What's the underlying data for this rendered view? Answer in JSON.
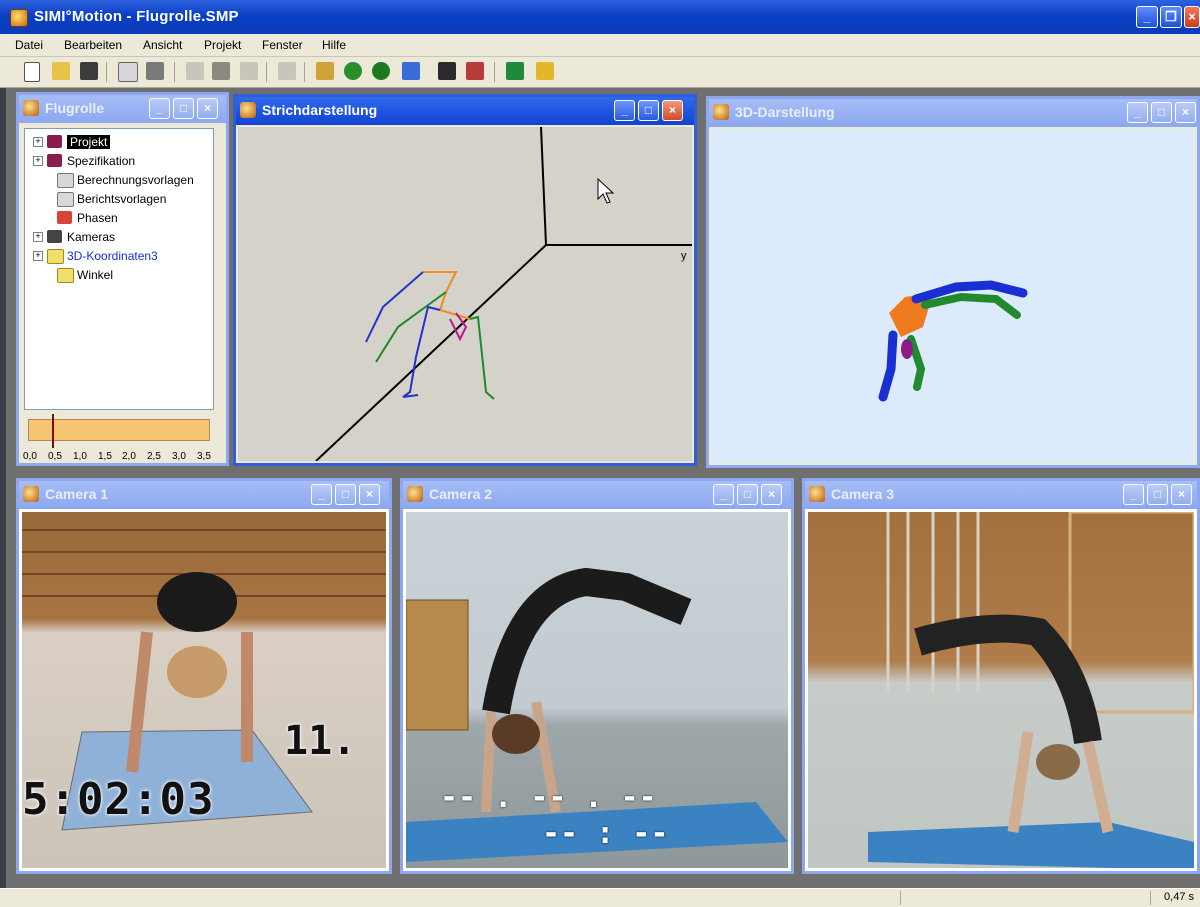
{
  "app": {
    "title": "SIMI°Motion - Flugrolle.SMP"
  },
  "menu": [
    "Datei",
    "Bearbeiten",
    "Ansicht",
    "Projekt",
    "Fenster",
    "Hilfe"
  ],
  "windows": {
    "flugrolle": {
      "title": "Flugrolle",
      "tree": [
        {
          "label": "Projekt",
          "expand": true,
          "selected": true,
          "icon": "book-icon"
        },
        {
          "label": "Spezifikation",
          "expand": true,
          "icon": "book-icon"
        },
        {
          "label": "Berechnungsvorlagen",
          "icon": "document-icon"
        },
        {
          "label": "Berichtsvorlagen",
          "icon": "document-icon"
        },
        {
          "label": "Phasen",
          "icon": "phases-icon"
        },
        {
          "label": "Kameras",
          "expand": true,
          "icon": "camera-icon"
        },
        {
          "label": "3D-Koordinaten3",
          "expand": true,
          "icon": "folder-icon",
          "highlight": true
        },
        {
          "label": "Winkel",
          "icon": "folder-icon"
        }
      ],
      "timeline_ticks": [
        "0,0",
        "0,5",
        "1,0",
        "1,5",
        "2,0",
        "2,5",
        "3,0",
        "3,5"
      ],
      "timeline_position": 0.45
    },
    "strich": {
      "title": "Strichdarstellung",
      "axis_label": "y"
    },
    "threed": {
      "title": "3D-Darstellung"
    },
    "camera1": {
      "title": "Camera 1",
      "timecode": "5:02:03",
      "overlay": "11."
    },
    "camera2": {
      "title": "Camera 2",
      "overlay_top": "-- . -- . --",
      "overlay_bottom": "-- : --"
    },
    "camera3": {
      "title": "Camera 3"
    }
  },
  "status": {
    "time": "0,47 s"
  },
  "colors": {
    "titlebar": "#0a3fc4",
    "accent": "#2f5fd7",
    "timeline": "#f7c572"
  }
}
